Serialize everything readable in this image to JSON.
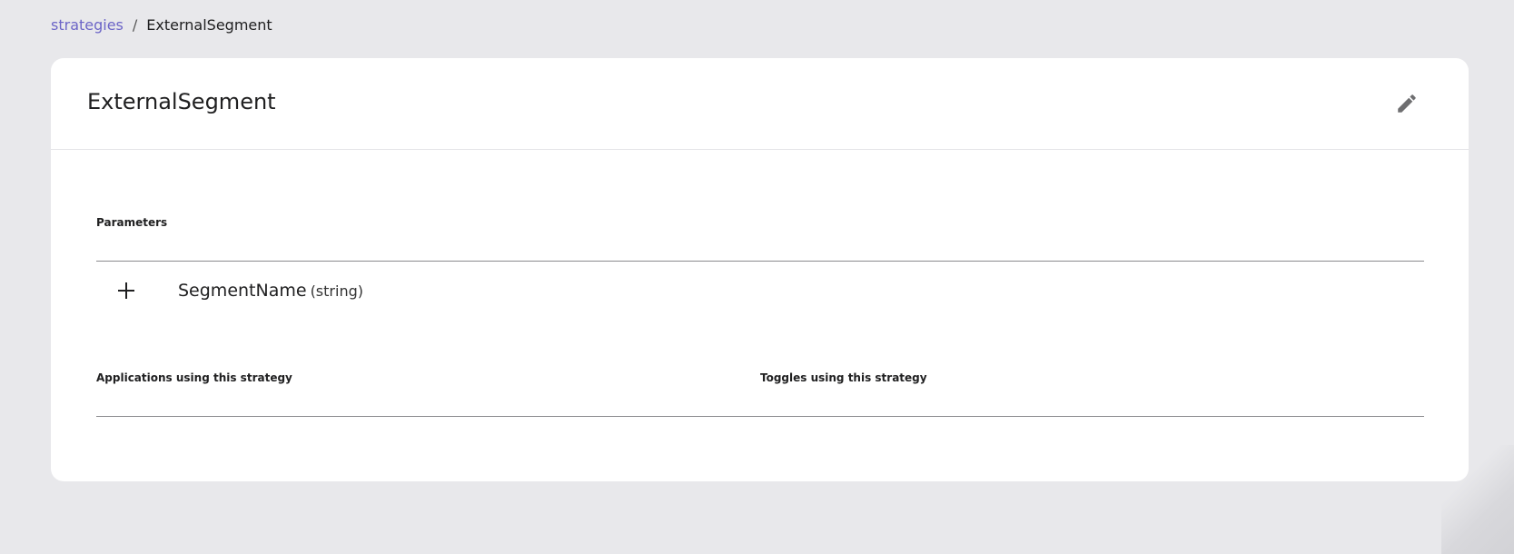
{
  "breadcrumb": {
    "link_label": "strategies",
    "separator": "/",
    "current": "ExternalSegment"
  },
  "card": {
    "title": "ExternalSegment",
    "edit_icon": "pencil-icon"
  },
  "parameters": {
    "label": "Parameters",
    "items": [
      {
        "name": "SegmentName",
        "type": "(string)",
        "icon": "plus-icon"
      }
    ]
  },
  "applications": {
    "label": "Applications using this strategy"
  },
  "toggles": {
    "label": "Toggles using this strategy"
  },
  "colors": {
    "background": "#e8e8eb",
    "card": "#ffffff",
    "link": "#6c65c7",
    "text": "#202021",
    "icon": "#6e6e70"
  }
}
